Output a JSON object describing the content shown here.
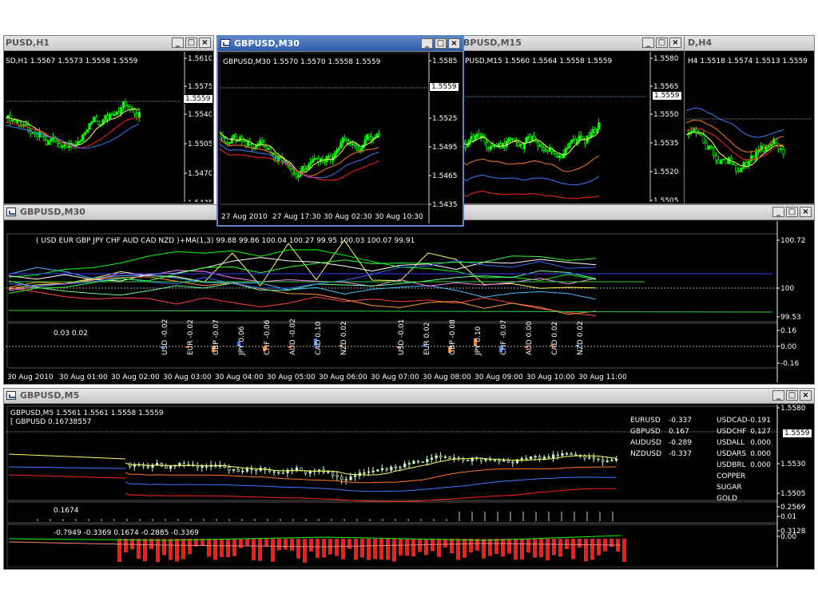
{
  "windows": {
    "h1": {
      "title": "PUSD,H1",
      "info": "SD,H1  1.5567 1.5573 1.5558 1.5559",
      "price_box": "1.5559",
      "scale": [
        "1.5610",
        "1.5575",
        "1.5540",
        "1.5505",
        "1.5470",
        "1.5435"
      ]
    },
    "m30": {
      "title": "GBPUSD,M30",
      "info": "GBPUSD,M30  1.5570 1.5570 1.5558 1.5559",
      "price_box": "1.5559",
      "scale": [
        "1.5585",
        "1.5555",
        "1.5525",
        "1.5495",
        "1.5465",
        "1.5435"
      ],
      "times": [
        "27 Aug 2010",
        "27 Aug 17:30",
        "30 Aug 02:30",
        "30 Aug 10:30"
      ]
    },
    "m15": {
      "title": "BPUSD,M15",
      "info": "PUSD,M15  1.5560 1.5564 1.5558 1.5559",
      "price_box": "1.5559",
      "scale": [
        "1.5580",
        "1.5565",
        "1.5550",
        "1.5535",
        "1.5520",
        "1.5505"
      ]
    },
    "h4": {
      "title": "D,H4",
      "info": "H4  1.5518 1.5574 1.5513 1.5559"
    },
    "strength": {
      "title": "GBPUSD,M30",
      "header": "( USD EUR GBP JPY CHF AUD CAD NZD )+MA(1,3) 99.88 99.86 100.04 100.27 99.95 100.03 100.07 99.91",
      "scale": [
        "100.72",
        "100",
        "99.53"
      ],
      "sub_info": "0.03 0.02",
      "sub_scale": [
        "0.16",
        "0.00",
        "-0.16"
      ],
      "bar_labels": [
        "USD -0.02",
        "EUR -0.02",
        "GBP -0.07",
        "JPY 0.06",
        "CHF -0.06",
        "AUD -0.02",
        "CAD 0.10",
        "NZD 0.02",
        "USD -0.01",
        "EUR 0.02",
        "GBP -0.08",
        "JPY 0.10",
        "CHF -0.07",
        "AUD 0.00",
        "CAD 0.02",
        "NZD 0.02"
      ],
      "times": [
        "30 Aug 2010",
        "30 Aug 01:00",
        "30 Aug 02:00",
        "30 Aug 03:00",
        "30 Aug 04:00",
        "30 Aug 05:00",
        "30 Aug 06:00",
        "30 Aug 07:00",
        "30 Aug 08:00",
        "30 Aug 09:00",
        "30 Aug 10:00",
        "30 Aug 11:00"
      ]
    },
    "m5": {
      "title": "GBPUSD,M5",
      "info": "GBPUSD,M5  1.5561 1.5561 1.5558 1.5559",
      "info2": "[ GBPUSD 0.16738557",
      "price_box": "1.5559",
      "scale": [
        "1.5580",
        "1.5530",
        "1.5505"
      ],
      "pairs_left": [
        {
          "name": "EURUSD",
          "value": "-0.337"
        },
        {
          "name": "GBPUSD",
          "value": "0.167"
        },
        {
          "name": "AUDUSD",
          "value": "-0.289"
        },
        {
          "name": "NZDUSD",
          "value": "-0.337"
        }
      ],
      "pairs_right": [
        {
          "name": "USDCAD",
          "value": "-0.191"
        },
        {
          "name": "USDCHF",
          "value": "0.127"
        },
        {
          "name": "USDALL",
          "value": "0.000"
        },
        {
          "name": "USDARS",
          "value": "0.000"
        },
        {
          "name": "USDBRL",
          "value": "0.000"
        },
        {
          "name": "COPPER",
          "value": ""
        },
        {
          "name": "SUGAR",
          "value": ""
        },
        {
          "name": "GOLD",
          "value": ""
        }
      ],
      "sub1_info": "0.1674",
      "sub1_scale": [
        "0.2569",
        "0.01"
      ],
      "sub2_info": "-0.7949 -0.3369 0.1674 -0.2885 -0.3369",
      "sub2_scale": [
        "0.3128",
        "0.00"
      ]
    }
  },
  "colors": {
    "green": "#00ff00",
    "yellow": "#ffff66",
    "red": "#ff2020",
    "blue": "#3a7bff",
    "orange": "#ff7a20",
    "neg": "#ff4040",
    "cyan": "#40c0ff"
  }
}
